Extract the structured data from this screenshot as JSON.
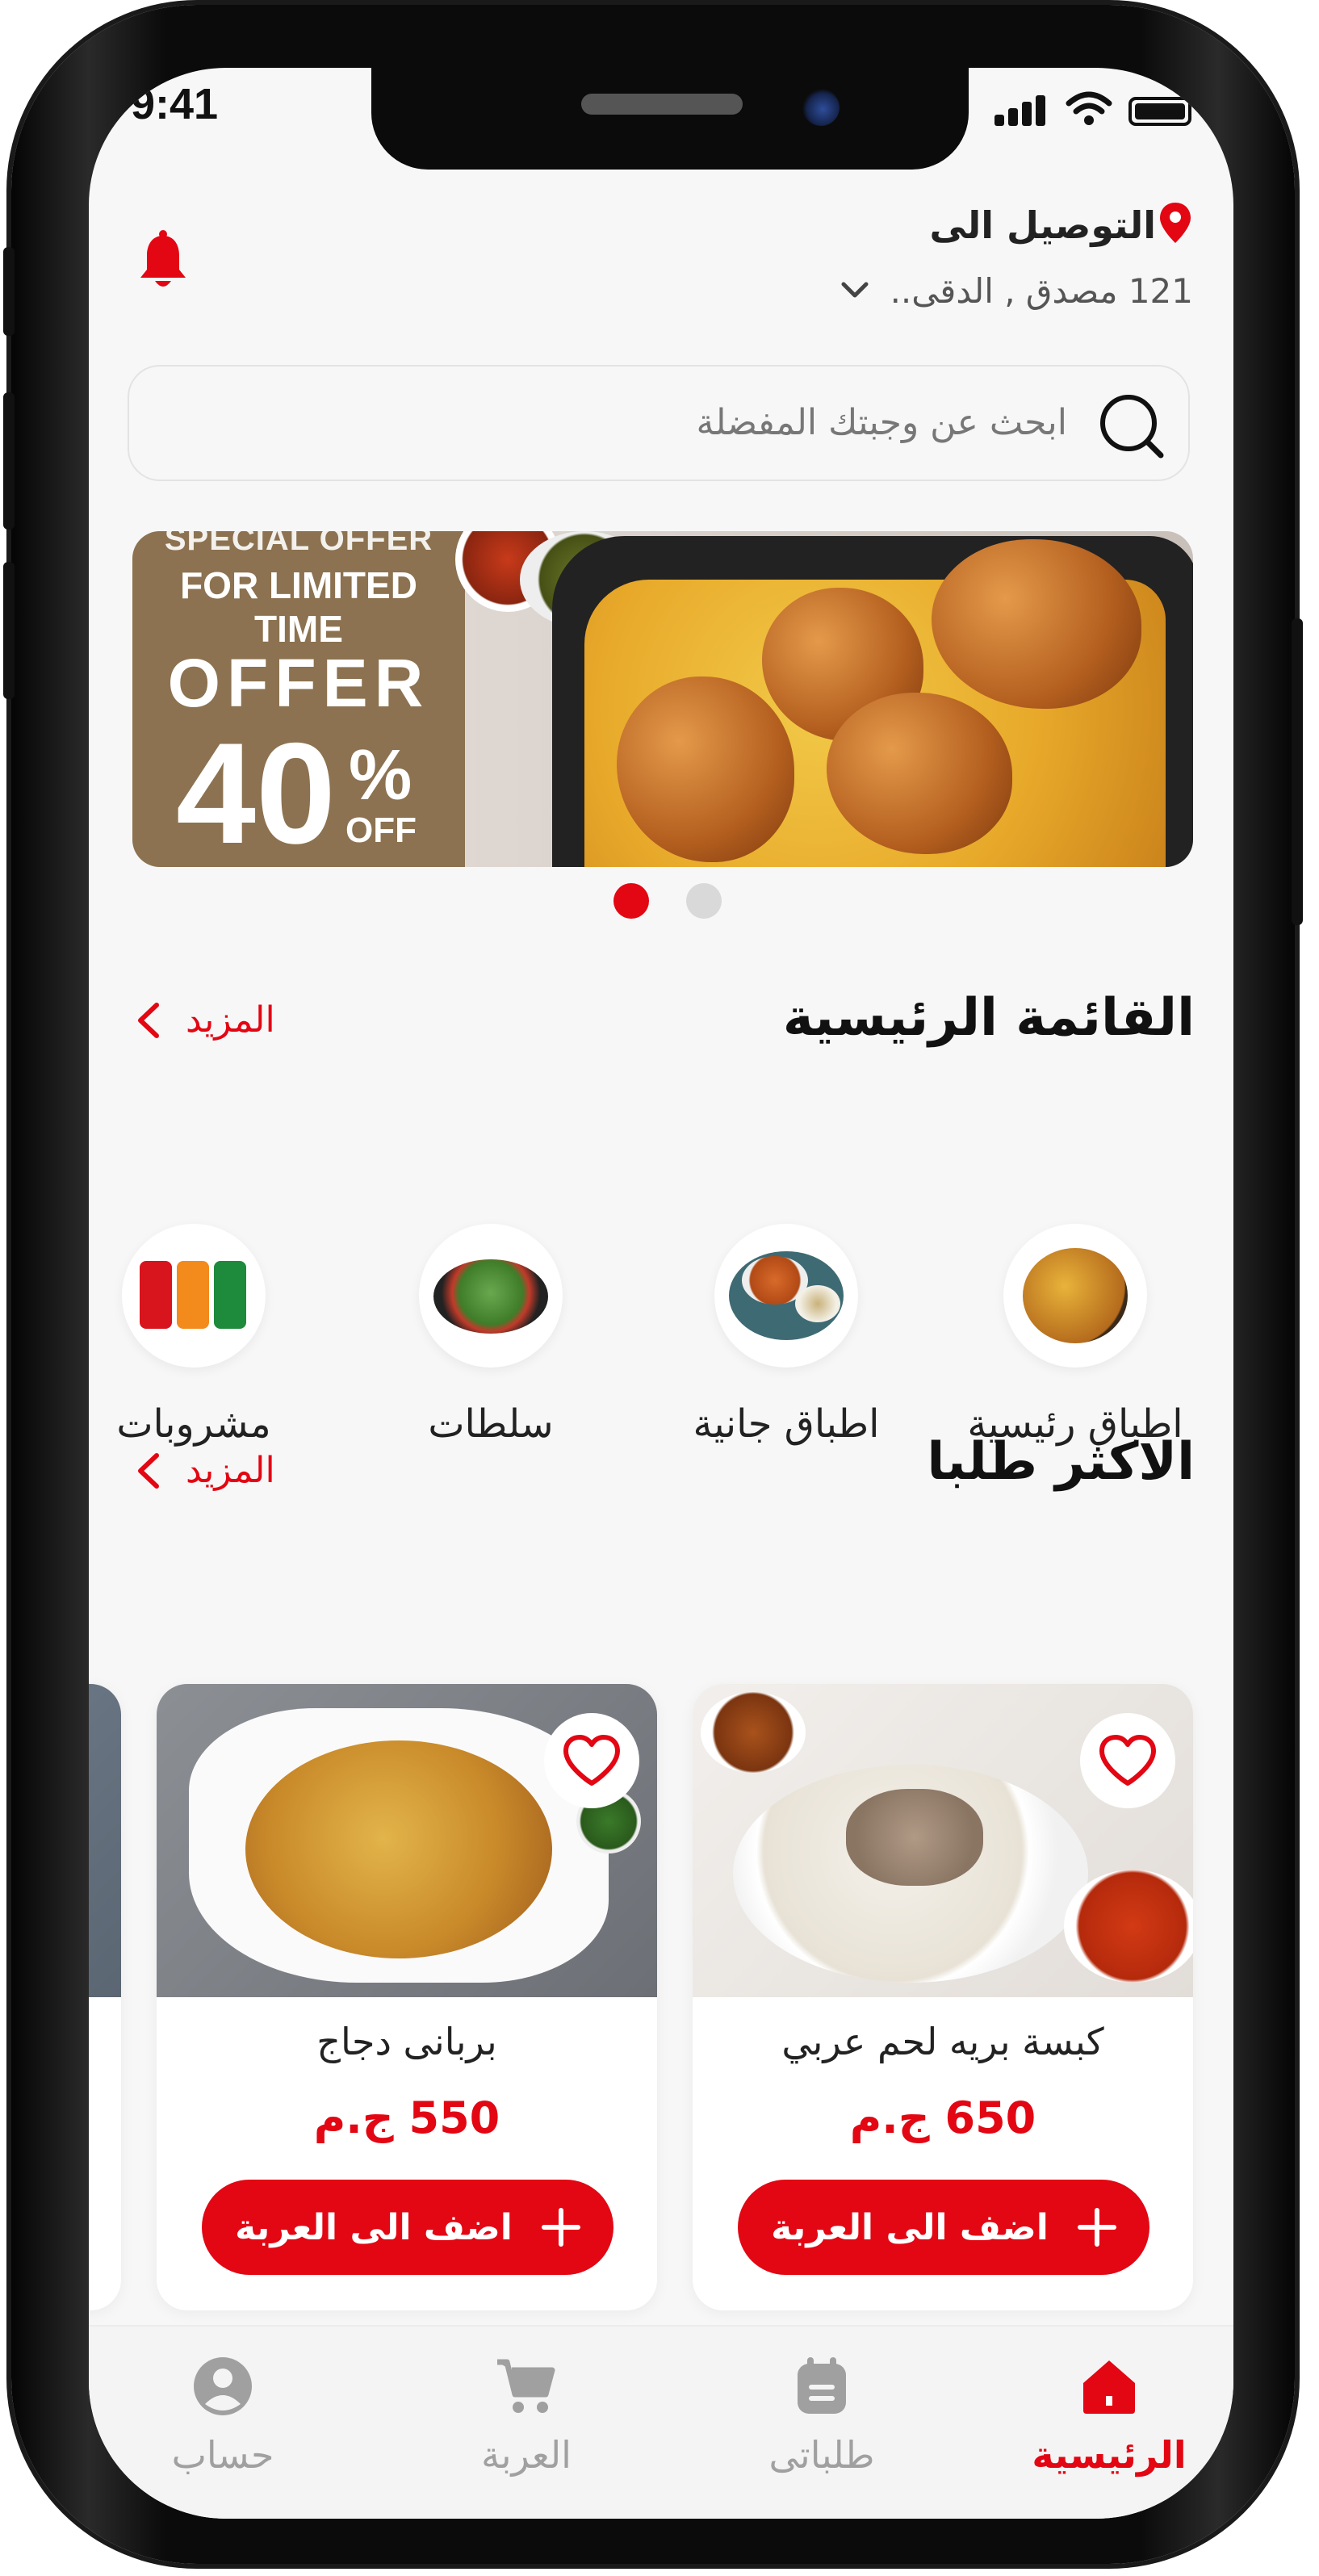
{
  "status_bar": {
    "time": "9:41"
  },
  "header": {
    "delivery_label": "التوصيل الى",
    "address": "121 مصدق , الدقى..",
    "icons": {
      "location": "location-pin-icon",
      "address_toggle": "chevron-down-icon",
      "notifications": "bell-icon"
    }
  },
  "search": {
    "placeholder": "ابحث عن  وجبتك المفضلة",
    "icon": "search-icon"
  },
  "banner": {
    "line1": "SPECIAL OFFER",
    "line2": "FOR LIMITED TIME",
    "offer_word": "OFFER",
    "discount": "40",
    "percent_sign": "%",
    "off_word": "OFF",
    "pagination": {
      "total": 2,
      "active": 1
    }
  },
  "main_menu": {
    "title": "القائمة الرئيسية",
    "more_label": "المزيد",
    "categories": [
      {
        "label": "اطباق رئيسية",
        "icon": "rice-plate-icon"
      },
      {
        "label": "اطباق جانية",
        "icon": "soup-bowl-icon"
      },
      {
        "label": "سلطات",
        "icon": "salad-icon"
      },
      {
        "label": "مشروبات",
        "icon": "soda-cans-icon"
      }
    ]
  },
  "popular": {
    "title": "الاكثر طلبا",
    "more_label": "المزيد",
    "products": [
      {
        "name": "كبسة بريه لحم عربي",
        "price": "650 ج.م",
        "add_label": "اضف الى العربة"
      },
      {
        "name": "بربانى دجاج",
        "price": "550 ج.م",
        "add_label": "اضف الى العربة"
      }
    ]
  },
  "bottom_nav": {
    "items": [
      {
        "label": "الرئيسية",
        "icon": "home-icon",
        "active": true
      },
      {
        "label": "طلباتى",
        "icon": "orders-icon",
        "active": false
      },
      {
        "label": "العربة",
        "icon": "cart-icon",
        "active": false
      },
      {
        "label": "حساب",
        "icon": "profile-icon",
        "active": false
      }
    ]
  },
  "colors": {
    "accent": "#e30613",
    "background": "#f7f7f7",
    "banner_panel": "#8c7250",
    "inactive": "#a0a0a0"
  }
}
